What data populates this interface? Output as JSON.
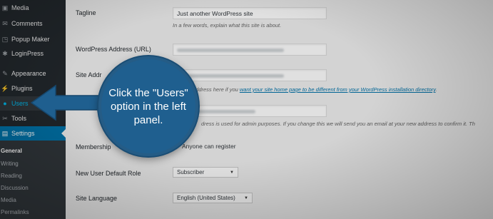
{
  "sidebar": {
    "items": [
      {
        "label": "Media",
        "icon": "media-icon",
        "glyph": "▣"
      },
      {
        "label": "Comments",
        "icon": "comments-icon",
        "glyph": "✉"
      },
      {
        "label": "Popup Maker",
        "icon": "popup-maker-icon",
        "glyph": "◳"
      },
      {
        "label": "LoginPress",
        "icon": "gear-icon",
        "glyph": "✱"
      },
      {
        "label": "Appearance",
        "icon": "paintbrush-icon",
        "glyph": "✎"
      },
      {
        "label": "Plugins",
        "icon": "plug-icon",
        "glyph": "⚡"
      },
      {
        "label": "Users",
        "icon": "user-icon",
        "glyph": "●"
      },
      {
        "label": "Tools",
        "icon": "wrench-icon",
        "glyph": "✂"
      },
      {
        "label": "Settings",
        "icon": "settings-icon",
        "glyph": "▤"
      }
    ],
    "submenu": [
      "General",
      "Writing",
      "Reading",
      "Discussion",
      "Media",
      "Permalinks"
    ]
  },
  "settings": {
    "tagline_label": "Tagline",
    "tagline_value": "Just another WordPress site",
    "tagline_desc": "In a few words, explain what this site is about.",
    "wp_address_label": "WordPress Address (URL)",
    "site_address_label": "Site Addr",
    "site_address_desc_pre": "address here if you ",
    "site_address_desc_link": "want your site home page to be different from your WordPress installation directory",
    "site_address_desc_post": ".",
    "email_desc": "dress is used for admin purposes. If you change this we will send you an email at your new address to confirm it. Th",
    "membership_label": "Membership",
    "membership_option": "Anyone can register",
    "default_role_label": "New User Default Role",
    "default_role_value": "Subscriber",
    "language_label": "Site Language",
    "language_value": "English (United States)"
  },
  "callout": {
    "text": "Click the \"Users\" option in the left panel."
  },
  "colors": {
    "sidebar_bg": "#23282d",
    "active_blue": "#0073aa",
    "callout_blue": "#1f5f8f"
  }
}
